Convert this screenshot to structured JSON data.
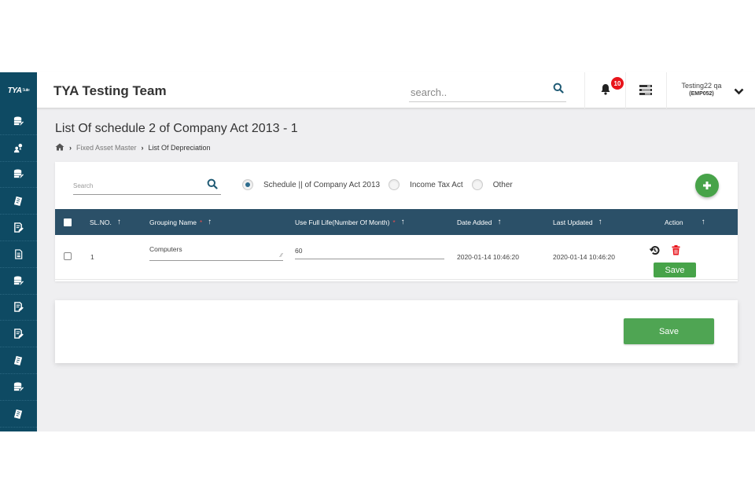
{
  "sidebar": {
    "logo": "TYA",
    "logo_suffix": "Suite",
    "items": [
      {
        "icon": "database-edit-icon"
      },
      {
        "icon": "user-location-icon"
      },
      {
        "icon": "database-edit-icon"
      },
      {
        "icon": "notepad-icon"
      },
      {
        "icon": "document-edit-icon"
      },
      {
        "icon": "document-icon"
      },
      {
        "icon": "database-edit-icon"
      },
      {
        "icon": "document-edit-icon"
      },
      {
        "icon": "document-edit-icon"
      },
      {
        "icon": "notepad-icon"
      },
      {
        "icon": "database-edit-icon"
      },
      {
        "icon": "notepad-icon"
      }
    ]
  },
  "header": {
    "title": "TYA Testing Team",
    "search_placeholder": "search..",
    "notification_count": "10",
    "user_name": "Testing22 qa",
    "user_id": "(EMP052)"
  },
  "page": {
    "title": "List Of schedule 2 of Company Act 2013 - 1",
    "breadcrumb": [
      "Fixed Asset Master",
      "List Of Depreciation"
    ]
  },
  "filters": {
    "search_placeholder": "Search",
    "radio_options": [
      {
        "label": "Schedule || of Company Act 2013",
        "selected": true
      },
      {
        "label": "Income Tax Act",
        "selected": false
      },
      {
        "label": "Other",
        "selected": false
      }
    ]
  },
  "table": {
    "columns": [
      {
        "label": "SL.NO.",
        "required": false,
        "sortable": true
      },
      {
        "label": "Grouping Name",
        "required": true,
        "sortable": true
      },
      {
        "label": "Use Full Life(Number Of Month)",
        "required": true,
        "sortable": true
      },
      {
        "label": "Date Added",
        "required": false,
        "sortable": true
      },
      {
        "label": "Last Updated",
        "required": false,
        "sortable": true
      },
      {
        "label": "Action",
        "required": false,
        "sortable": true
      }
    ],
    "required_mark": "*",
    "sort_arrow": "↑",
    "rows": [
      {
        "sl_no": "1",
        "grouping_name": "Computers",
        "useful_life": "60",
        "date_added": "2020-01-14 10:46:20",
        "last_updated": "2020-01-14 10:46:20",
        "save_label": "Save"
      }
    ]
  },
  "footer": {
    "save_label": "Save"
  },
  "colors": {
    "sidebar": "#0e4a63",
    "table_header": "#2b5068",
    "success": "#47a349",
    "danger": "#e8141b"
  }
}
